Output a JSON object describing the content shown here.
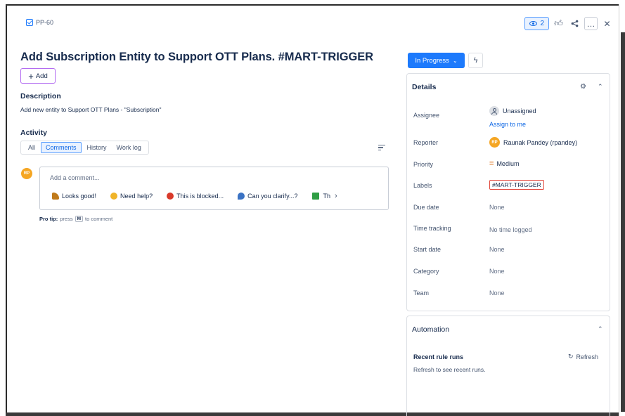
{
  "issue": {
    "key": "PP-60",
    "title": "Add Subscription Entity to Support OTT Plans. #MART-TRIGGER",
    "add_label": "Add"
  },
  "toolbar": {
    "watch_count": "2",
    "more_label": "…"
  },
  "description": {
    "heading": "Description",
    "text": "Add new entity to Support OTT Plans - \"Subscription\""
  },
  "activity": {
    "heading": "Activity",
    "tabs": [
      {
        "label": "All",
        "selected": false
      },
      {
        "label": "Comments",
        "selected": true
      },
      {
        "label": "History",
        "selected": false
      },
      {
        "label": "Work log",
        "selected": false
      }
    ],
    "comment": {
      "avatar_initials": "RP",
      "placeholder": "Add a comment...",
      "quick_replies": [
        {
          "label": "Looks good!",
          "icon": "thumbs-up-icon"
        },
        {
          "label": "Need help?",
          "icon": "wave-icon"
        },
        {
          "label": "This is blocked...",
          "icon": "no-entry-icon"
        },
        {
          "label": "Can you clarify...?",
          "icon": "magnifier-icon"
        },
        {
          "label": "Th",
          "icon": "checkmark-icon"
        }
      ],
      "protip_bold": "Pro tip:",
      "protip_pre": "press",
      "protip_key": "M",
      "protip_post": "to comment"
    }
  },
  "sidebar": {
    "status": "In Progress",
    "details": {
      "heading": "Details",
      "fields": {
        "assignee": {
          "label": "Assignee",
          "value": "Unassigned",
          "action": "Assign to me"
        },
        "reporter": {
          "label": "Reporter",
          "value": "Raunak Pandey (rpandey)",
          "initials": "RP"
        },
        "priority": {
          "label": "Priority",
          "value": "Medium"
        },
        "labels": {
          "label": "Labels",
          "value": "#MART-TRIGGER"
        },
        "due_date": {
          "label": "Due date",
          "value": "None"
        },
        "time_tracking": {
          "label": "Time tracking",
          "value": "No time logged"
        },
        "start_date": {
          "label": "Start date",
          "value": "None"
        },
        "category": {
          "label": "Category",
          "value": "None"
        },
        "team": {
          "label": "Team",
          "value": "None"
        }
      }
    },
    "automation": {
      "heading": "Automation",
      "recent_heading": "Recent rule runs",
      "refresh_label": "Refresh",
      "hint": "Refresh to see recent runs."
    }
  },
  "colors": {
    "accent": "#1d7afc",
    "label_border": "#e2483d",
    "avatar": "#f5a623",
    "add_border": "#b36cf1"
  }
}
